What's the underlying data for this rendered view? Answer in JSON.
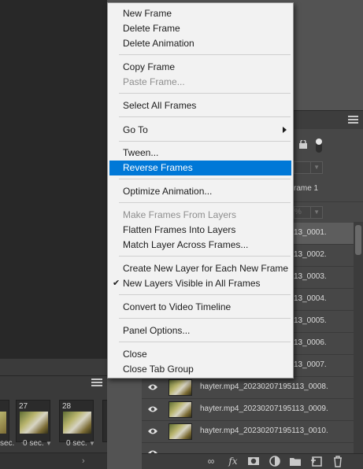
{
  "context_menu": {
    "items": [
      {
        "label": "New Frame",
        "disabled": false
      },
      {
        "label": "Delete Frame",
        "disabled": false
      },
      {
        "label": "Delete Animation",
        "disabled": false
      },
      {
        "label": "Copy Frame",
        "disabled": false
      },
      {
        "label": "Paste Frame...",
        "disabled": true
      },
      {
        "label": "Select All Frames",
        "disabled": false
      },
      {
        "label": "Go To",
        "disabled": false,
        "submenu": true
      },
      {
        "label": "Tween...",
        "disabled": false
      },
      {
        "label": "Reverse Frames",
        "disabled": false,
        "highlighted": true
      },
      {
        "label": "Optimize Animation...",
        "disabled": false
      },
      {
        "label": "Make Frames From Layers",
        "disabled": true
      },
      {
        "label": "Flatten Frames Into Layers",
        "disabled": false
      },
      {
        "label": "Match Layer Across Frames...",
        "disabled": false
      },
      {
        "label": "Create New Layer for Each New Frame",
        "disabled": false
      },
      {
        "label": "New Layers Visible in All Frames",
        "disabled": false,
        "checked": true
      },
      {
        "label": "Convert to Video Timeline",
        "disabled": false
      },
      {
        "label": "Panel Options...",
        "disabled": false
      },
      {
        "label": "Close",
        "disabled": false
      },
      {
        "label": "Close Tab Group",
        "disabled": false
      }
    ],
    "highlight_color": "#0078d7"
  },
  "timeline": {
    "frames": [
      {
        "number": "27",
        "delay": "0 sec."
      },
      {
        "number": "28",
        "delay": "0 sec."
      }
    ],
    "left_delay": "sec."
  },
  "layers_panel": {
    "opacity_value": "%",
    "fill_value": "%",
    "frame_label": "rame 1",
    "layers": [
      {
        "name": "13_0001.",
        "selected": true,
        "visible": false,
        "truncated": true
      },
      {
        "name": "13_0002.",
        "selected": false,
        "visible": false,
        "truncated": true
      },
      {
        "name": "13_0003.",
        "selected": false,
        "visible": false,
        "truncated": true
      },
      {
        "name": "13_0004.",
        "selected": false,
        "visible": false,
        "truncated": true
      },
      {
        "name": "13_0005.",
        "selected": false,
        "visible": false,
        "truncated": true
      },
      {
        "name": "13_0006.",
        "selected": false,
        "visible": false,
        "truncated": true
      },
      {
        "name": "13_0007.",
        "selected": false,
        "visible": false,
        "truncated": true
      },
      {
        "name": "hayter.mp4_20230207195113_0008.",
        "selected": false,
        "visible": true,
        "truncated": false
      },
      {
        "name": "hayter.mp4_20230207195113_0009.",
        "selected": false,
        "visible": true,
        "truncated": false
      },
      {
        "name": "hayter.mp4_20230207195113_0010.",
        "selected": false,
        "visible": true,
        "truncated": false
      }
    ],
    "footer_icons": [
      "link-icon",
      "fx-icon",
      "mask-icon",
      "adjustment-icon",
      "folder-icon",
      "new-layer-icon",
      "trash-icon"
    ],
    "footer_fx_label": "fx"
  }
}
